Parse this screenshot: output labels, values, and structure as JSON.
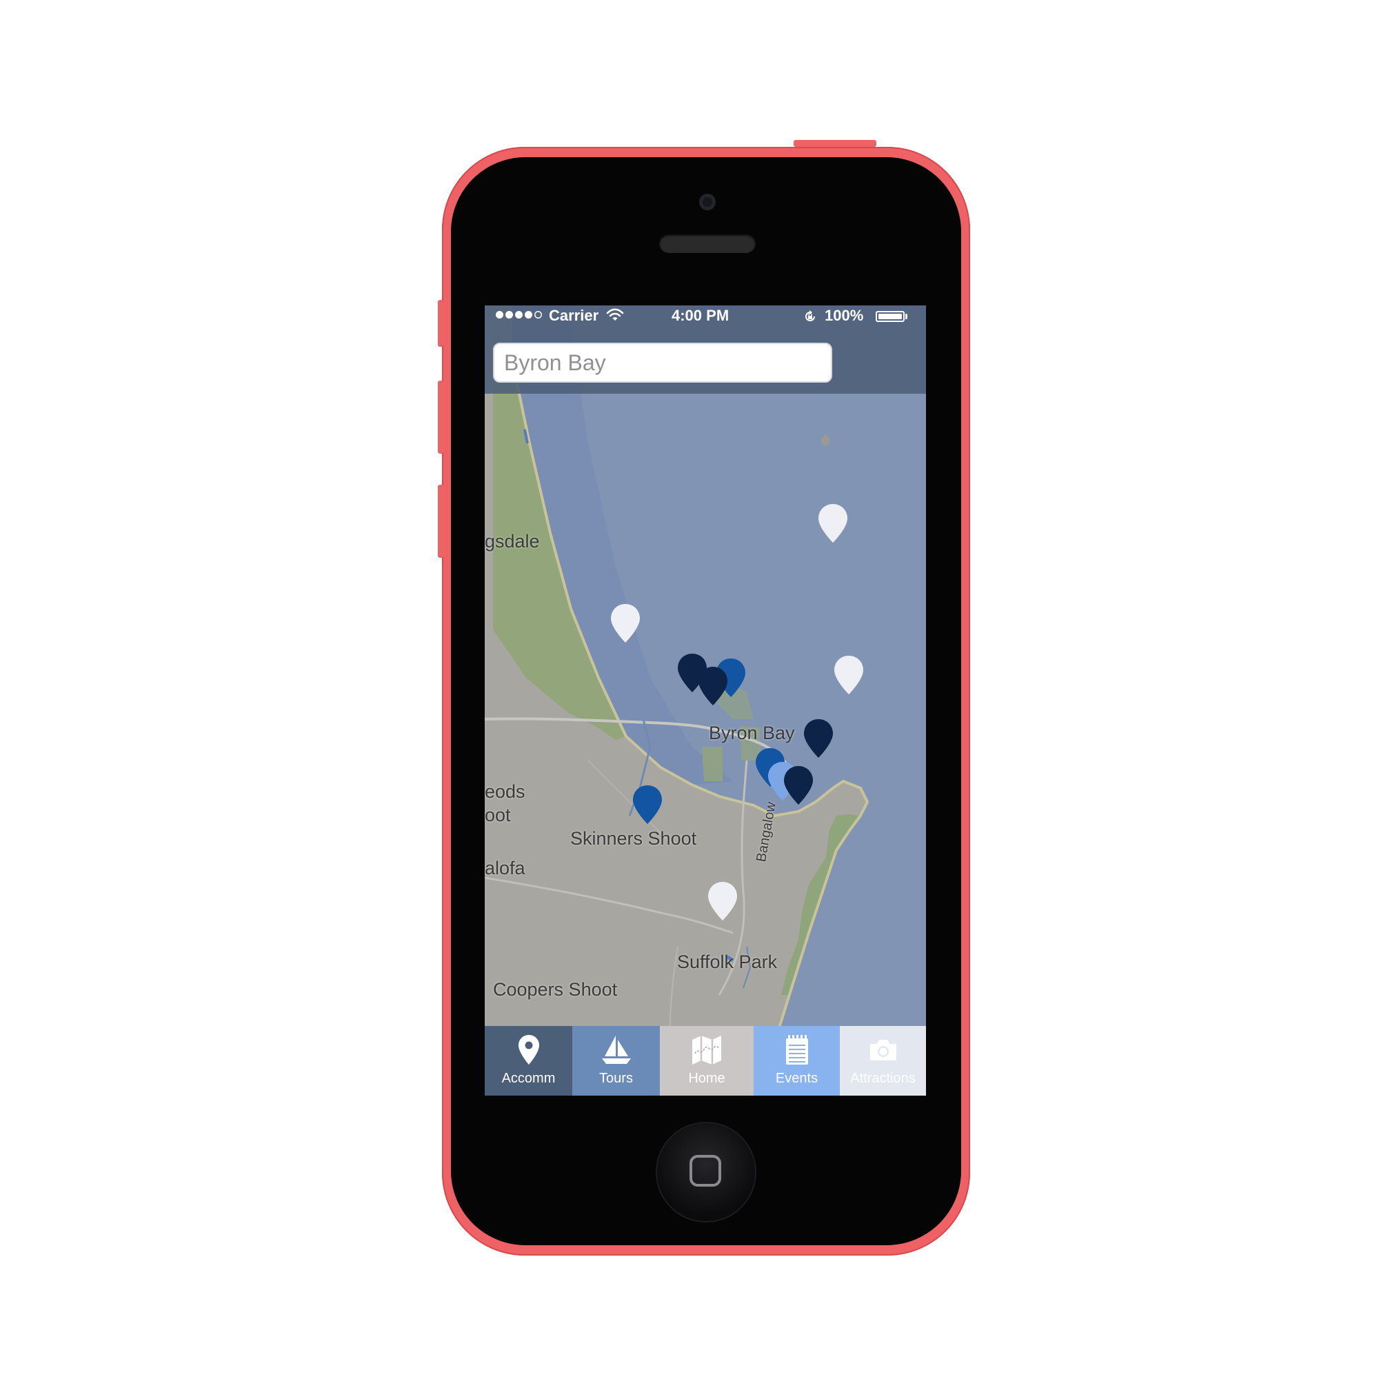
{
  "status_bar": {
    "carrier": "Carrier",
    "time": "4:00 PM",
    "battery": "100%",
    "signal_bars_filled": 4,
    "signal_bars_total": 5,
    "battery_level": 1.0
  },
  "search": {
    "placeholder": "Byron Bay"
  },
  "map": {
    "labels": {
      "brunswick": "gsdale",
      "byron_bay": "Byron Bay",
      "mcleods_1": "eods",
      "mcleods_2": "oot",
      "skinners": "Skinners Shoot",
      "talofa": "alofa",
      "bangalow": "Bangalow",
      "suffolk": "Suffolk Park",
      "coopers": "Coopers Shoot"
    },
    "colors": {
      "land": "#a7a6a0",
      "sea": "#8294b4",
      "park": "#93a57a"
    },
    "marker_colors": {
      "white": "#eef0f6",
      "dark_navy": "#0d2347",
      "blue": "#1255a3",
      "light_blue": "#7ca6e6"
    }
  },
  "tabs": [
    {
      "label": "Accomm",
      "icon": "map-pin-icon",
      "color": "#4c5f78"
    },
    {
      "label": "Tours",
      "icon": "sailboat-icon",
      "color": "#6a8bb8"
    },
    {
      "label": "Home",
      "icon": "folded-map-icon",
      "color": "#cbc6c6"
    },
    {
      "label": "Events",
      "icon": "notepad-icon",
      "color": "#88b3ee"
    },
    {
      "label": "Attractions",
      "icon": "camera-icon",
      "color": "#e3e7ef"
    }
  ],
  "device": {
    "body_color": "#ee6266"
  }
}
